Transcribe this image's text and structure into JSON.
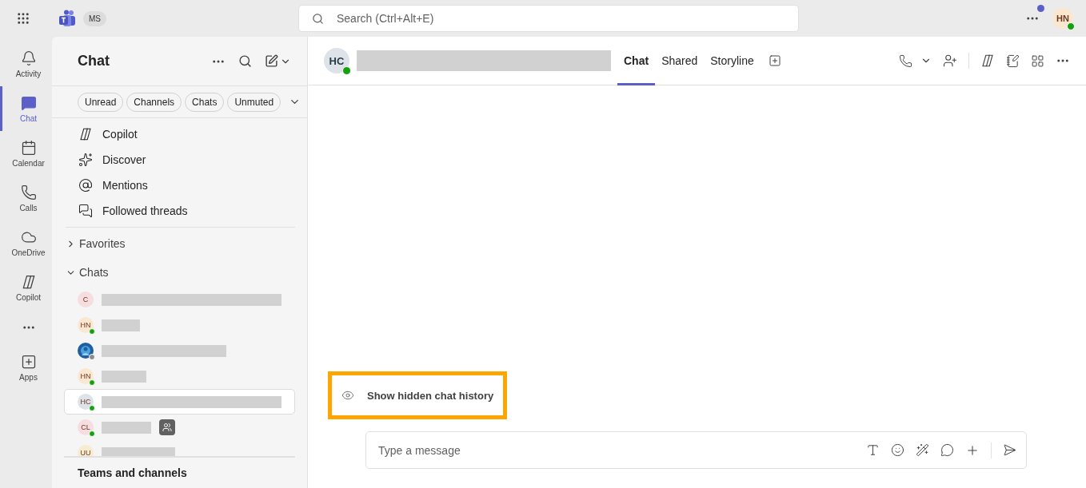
{
  "top_bar": {
    "org_badge": "MS",
    "search": {
      "placeholder": "Search (Ctrl+Alt+E)"
    },
    "user": {
      "initials": "HN",
      "presence": {
        "color": "#13a10e"
      },
      "notification": true
    }
  },
  "rail": [
    {
      "kind": "activity",
      "label": "Activity",
      "selected": false
    },
    {
      "kind": "chat",
      "label": "Chat",
      "selected": true
    },
    {
      "kind": "calendar",
      "label": "Calendar",
      "selected": false
    },
    {
      "kind": "calls",
      "label": "Calls",
      "selected": false
    },
    {
      "kind": "onedrive",
      "label": "OneDrive",
      "selected": false
    },
    {
      "kind": "copilot",
      "label": "Copilot",
      "selected": false
    },
    {
      "kind": "more"
    },
    {
      "kind": "apps",
      "label": "Apps",
      "selected": false
    }
  ],
  "chat_panel": {
    "title": "Chat",
    "filters": [
      {
        "label": "Unread"
      },
      {
        "label": "Channels"
      },
      {
        "label": "Chats"
      },
      {
        "label": "Unmuted"
      }
    ],
    "nav": [
      {
        "kind": "copilot",
        "label": "Copilot"
      },
      {
        "kind": "discover",
        "label": "Discover"
      },
      {
        "kind": "mentions",
        "label": "Mentions"
      },
      {
        "kind": "threads",
        "label": "Followed threads"
      }
    ],
    "sections": [
      {
        "label": "Favorites",
        "expanded": false
      },
      {
        "label": "Chats",
        "expanded": true
      }
    ],
    "chats": [
      {
        "kind": "group",
        "initials": "C",
        "color": "#f6dde0",
        "selected": false,
        "badge": false
      },
      {
        "kind": "person",
        "initials": "HN",
        "color": "#fbe6d0",
        "presence": {
          "color": "#13a10e"
        },
        "selected": false,
        "badge": false
      },
      {
        "kind": "picture",
        "presence": {
          "color": "#8a8a8a"
        },
        "selected": false,
        "badge": false
      },
      {
        "kind": "person",
        "initials": "HN",
        "color": "#fbe6d0",
        "presence": {
          "color": "#13a10e"
        },
        "selected": false,
        "badge": false
      },
      {
        "kind": "person",
        "initials": "HC",
        "color": "#dde3e8",
        "presence": {
          "color": "#13a10e"
        },
        "selected": true,
        "badge": false
      },
      {
        "kind": "person",
        "initials": "CL",
        "color": "#f6dde0",
        "presence": {
          "color": "#13a10e"
        },
        "selected": false,
        "badge": true
      },
      {
        "kind": "person",
        "initials": "UU",
        "color": "#f8ecd0",
        "selected": false,
        "badge": false
      }
    ],
    "footer": "Teams and channels"
  },
  "conversation": {
    "avatar": {
      "initials": "HC",
      "presence": {
        "color": "#13a10e"
      }
    },
    "tabs": [
      {
        "label": "Chat",
        "selected": true
      },
      {
        "label": "Shared",
        "selected": false
      },
      {
        "label": "Storyline",
        "selected": false
      }
    ],
    "history_button": {
      "label": "Show hidden chat history",
      "highlighted": true
    },
    "composer": {
      "placeholder": "Type a message"
    }
  }
}
